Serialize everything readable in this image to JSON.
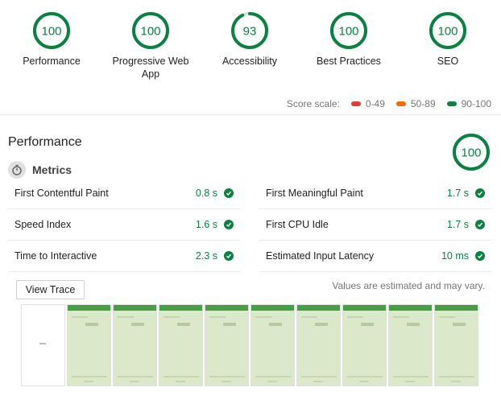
{
  "gauges": [
    {
      "score": "100",
      "value": 100,
      "label": "Performance"
    },
    {
      "score": "100",
      "value": 100,
      "label": "Progressive Web App"
    },
    {
      "score": "93",
      "value": 93,
      "label": "Accessibility"
    },
    {
      "score": "100",
      "value": 100,
      "label": "Best Practices"
    },
    {
      "score": "100",
      "value": 100,
      "label": "SEO"
    }
  ],
  "scale": {
    "label": "Score scale:",
    "items": [
      {
        "range": "0-49",
        "color": "#e53935"
      },
      {
        "range": "50-89",
        "color": "#ef6c00"
      },
      {
        "range": "90-100",
        "color": "#0b8043"
      }
    ]
  },
  "performance": {
    "title": "Performance",
    "score": "100",
    "value": 100,
    "metrics_title": "Metrics",
    "metrics": [
      {
        "name": "First Contentful Paint",
        "value": "0.8 s"
      },
      {
        "name": "First Meaningful Paint",
        "value": "1.7 s"
      },
      {
        "name": "Speed Index",
        "value": "1.6 s"
      },
      {
        "name": "First CPU Idle",
        "value": "1.7 s"
      },
      {
        "name": "Time to Interactive",
        "value": "2.3 s"
      },
      {
        "name": "Estimated Input Latency",
        "value": "10 ms"
      }
    ],
    "view_trace": "View Trace",
    "estimate_note": "Values are estimated and may vary."
  },
  "colors": {
    "pass": "#0b8043",
    "track": "#e0e0e0"
  },
  "filmstrip_frames": 10
}
